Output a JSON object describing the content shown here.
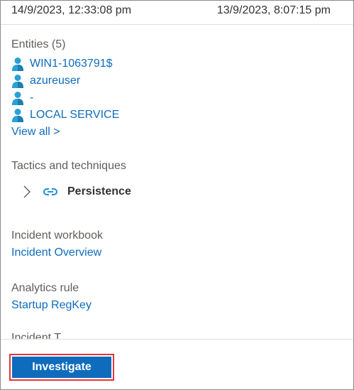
{
  "header": {
    "date_left": "14/9/2023, 12:33:08 pm",
    "date_right": "13/9/2023, 8:07:15 pm"
  },
  "entities": {
    "label": "Entities (5)",
    "items": [
      {
        "label": "WIN1-1063791$",
        "icon": "user-icon"
      },
      {
        "label": "azureuser",
        "icon": "user-icon"
      },
      {
        "label": "-",
        "icon": "user-icon"
      },
      {
        "label": "LOCAL SERVICE",
        "icon": "user-icon"
      }
    ],
    "view_all": "View all >"
  },
  "tactics": {
    "label": "Tactics and techniques",
    "item": "Persistence"
  },
  "workbook": {
    "label": "Incident workbook",
    "link": "Incident Overview"
  },
  "analytics": {
    "label": "Analytics rule",
    "link": "Startup RegKey"
  },
  "truncated_label": "Incident T",
  "footer": {
    "investigate_label": "Investigate"
  },
  "colors": {
    "link": "#0f6cbd",
    "button": "#0f6cbd",
    "highlight_outline": "#e0353f",
    "user_icon": "#2aa0d8"
  }
}
